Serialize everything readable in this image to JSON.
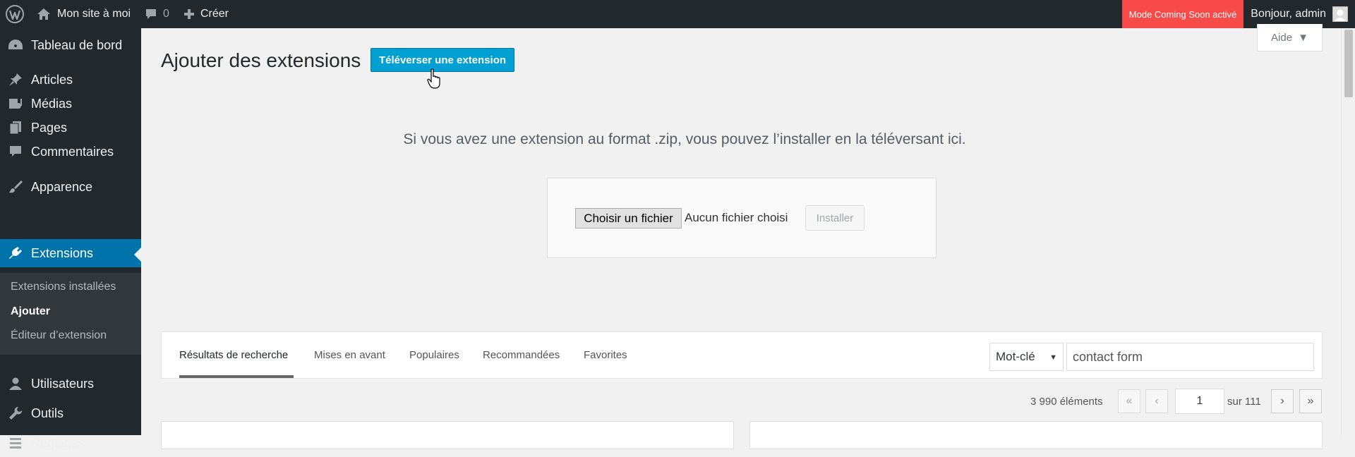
{
  "adminbar": {
    "site_name": "Mon site à moi",
    "comments_count": "0",
    "new_label": "Créer",
    "coming_soon": "Mode Coming Soon activé",
    "greeting": "Bonjour, admin"
  },
  "menu": {
    "items": [
      {
        "label": "Tableau de bord",
        "icon": "dashboard-icon"
      },
      {
        "label": "Articles",
        "icon": "pin-icon"
      },
      {
        "label": "Médias",
        "icon": "media-icon"
      },
      {
        "label": "Pages",
        "icon": "pages-icon"
      },
      {
        "label": "Commentaires",
        "icon": "comment-icon"
      },
      {
        "label": "Apparence",
        "icon": "brush-icon"
      },
      {
        "label": "Extensions",
        "icon": "plugin-icon"
      },
      {
        "label": "Utilisateurs",
        "icon": "users-icon"
      },
      {
        "label": "Outils",
        "icon": "wrench-icon"
      },
      {
        "label": "Réglages",
        "icon": "settings-icon"
      }
    ],
    "submenu": [
      "Extensions installées",
      "Ajouter",
      "Éditeur d’extension"
    ]
  },
  "page": {
    "title": "Ajouter des extensions",
    "upload_button": "Téléverser une extension",
    "help": "Aide"
  },
  "upload": {
    "message": "Si vous avez une extension au format .zip, vous pouvez l’installer en la téléversant ici.",
    "choose_file": "Choisir un fichier",
    "no_file": "Aucun fichier choisi",
    "install": "Installer"
  },
  "filters": {
    "tabs": [
      "Résultats de recherche",
      "Mises en avant",
      "Populaires",
      "Recommandées",
      "Favorites"
    ],
    "search_type": "Mot-clé",
    "search_value": "contact form"
  },
  "pagination": {
    "count": "3 990 éléments",
    "first": "«",
    "prev": "‹",
    "current_page": "1",
    "total": "sur 111",
    "next": "›",
    "last": "»"
  },
  "colors": {
    "admin_bar": "#23282d",
    "accent": "#0073aa",
    "upload_button": "#00a0d2",
    "coming_soon": "#f94a4a"
  }
}
